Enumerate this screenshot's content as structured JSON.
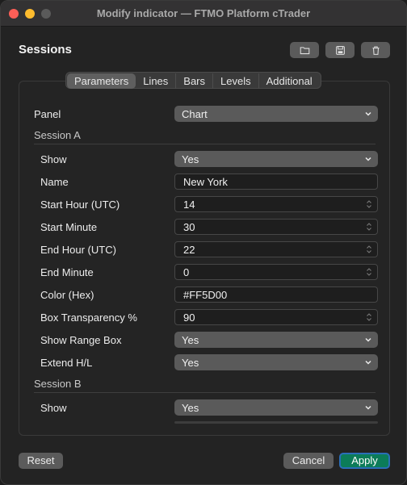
{
  "window": {
    "title": "Modify indicator — FTMO Platform cTrader"
  },
  "header": {
    "title": "Sessions"
  },
  "tabs": [
    "Parameters",
    "Lines",
    "Bars",
    "Levels",
    "Additional"
  ],
  "active_tab": "Parameters",
  "panel_row": {
    "label": "Panel",
    "value": "Chart"
  },
  "session_a": {
    "heading": "Session A",
    "rows": [
      {
        "label": "Show",
        "value": "Yes",
        "type": "select"
      },
      {
        "label": "Name",
        "value": "New York",
        "type": "text"
      },
      {
        "label": "Start Hour (UTC)",
        "value": "14",
        "type": "number"
      },
      {
        "label": "Start Minute",
        "value": "30",
        "type": "number"
      },
      {
        "label": "End Hour (UTC)",
        "value": "22",
        "type": "number"
      },
      {
        "label": "End Minute",
        "value": "0",
        "type": "number"
      },
      {
        "label": "Color (Hex)",
        "value": "#FF5D00",
        "type": "text"
      },
      {
        "label": "Box Transparency %",
        "value": "90",
        "type": "number"
      },
      {
        "label": "Show Range Box",
        "value": "Yes",
        "type": "select"
      },
      {
        "label": "Extend H/L",
        "value": "Yes",
        "type": "select"
      }
    ]
  },
  "session_b": {
    "heading": "Session B",
    "rows": [
      {
        "label": "Show",
        "value": "Yes",
        "type": "select"
      }
    ]
  },
  "footer": {
    "reset": "Reset",
    "cancel": "Cancel",
    "apply": "Apply"
  },
  "colors": {
    "apply_bg": "#0c7c59",
    "apply_border": "#2a6fb8",
    "close": "#fe5f57",
    "minimize": "#febc2e"
  },
  "icons": {
    "folder": "folder-icon",
    "save": "save-icon",
    "trash": "trash-icon"
  }
}
